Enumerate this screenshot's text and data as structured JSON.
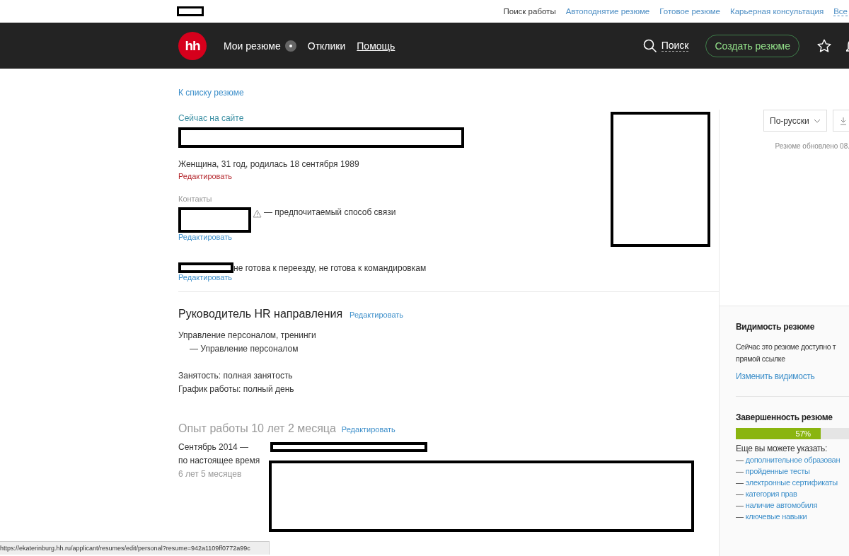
{
  "top_links": [
    {
      "label": "Поиск работы",
      "kind": "current"
    },
    {
      "label": "Автоподнятие резюме",
      "kind": "link"
    },
    {
      "label": "Готовое резюме",
      "kind": "link"
    },
    {
      "label": "Карьерная консультация",
      "kind": "link"
    },
    {
      "label": "Все",
      "kind": "dashed"
    }
  ],
  "header": {
    "logo": "hh",
    "nav": [
      {
        "label": "Мои резюме",
        "badge": true,
        "underlined": false
      },
      {
        "label": "Отклики",
        "badge": false,
        "underlined": false
      },
      {
        "label": "Помощь",
        "badge": false,
        "underlined": true
      }
    ],
    "search": "Поиск",
    "create_button": "Создать резюме"
  },
  "back_link": "К списку резюме",
  "online_status": "Сейчас на сайте",
  "personal": {
    "text": "Женщина, 31 год, родилась 18 сентября 1989",
    "edit": "Редактировать"
  },
  "contacts": {
    "label": "Контакты",
    "preferred": "— предпочитаемый способ связи",
    "edit": "Редактировать"
  },
  "relocation": {
    "text": "не готова к переезду, не готова к командировкам",
    "edit": "Редактировать"
  },
  "position": {
    "title": "Руководитель HR направления",
    "edit": "Редактировать",
    "field": "Управление персоналом, тренинги",
    "subfield": "— Управление персоналом",
    "employment": "Занятость: полная занятость",
    "schedule": "График работы: полный день"
  },
  "experience": {
    "title": "Опыт работы 10 лет 2 месяца",
    "edit": "Редактировать",
    "jobs": [
      {
        "start": "Сентябрь 2014 —",
        "end": "по настоящее время",
        "duration": "6 лет 5 месяцев"
      }
    ]
  },
  "sidebar": {
    "language": "По-русски",
    "updated": "Резюме обновлено 08.",
    "visibility": {
      "title": "Видимость резюме",
      "lines": [
        "Сейчас это резюме доступно т",
        "прямой ссылке"
      ],
      "link": "Изменить видимость"
    },
    "completeness": {
      "title": "Завершенность резюме",
      "level": 0.57,
      "reading": "57%",
      "hint": "Еще вы можете указать:",
      "items": [
        {
          "dash": "—",
          "label": "дополнительное образован"
        },
        {
          "dash": "—",
          "label": "пройденные тесты"
        },
        {
          "dash": "—",
          "label": "электронные сертификаты"
        },
        {
          "dash": "—",
          "label": "категория прав"
        },
        {
          "dash": "—",
          "label": "наличие автомобиля"
        },
        {
          "dash": "—",
          "label": "ключевые навыки"
        }
      ]
    }
  },
  "status_bar": {
    "url": "https://ekaterinburg.hh.ru/applicant/resumes/edit/personal?resume=942a1109ff0772a99c"
  }
}
